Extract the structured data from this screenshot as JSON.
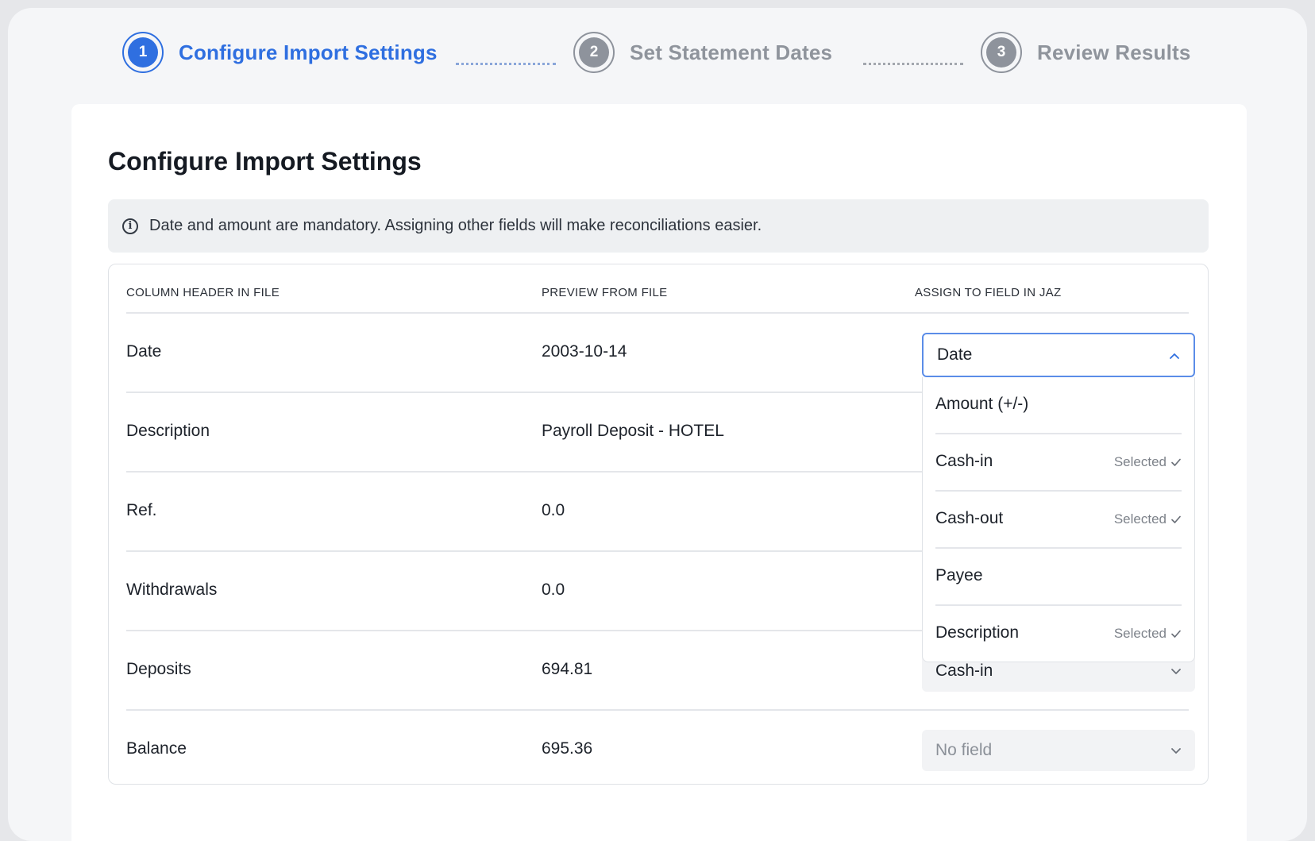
{
  "stepper": {
    "steps": [
      {
        "number": "1",
        "label": "Configure Import Settings"
      },
      {
        "number": "2",
        "label": "Set Statement Dates"
      },
      {
        "number": "3",
        "label": "Review Results"
      }
    ]
  },
  "page": {
    "title": "Configure Import Settings",
    "info": "Date and amount are mandatory. Assigning other fields will make reconciliations easier."
  },
  "table": {
    "headers": [
      "COLUMN HEADER IN FILE",
      "PREVIEW FROM FILE",
      "ASSIGN TO FIELD IN JAZ"
    ],
    "rows": [
      {
        "column": "Date",
        "preview": "2003-10-14",
        "assigned": "Date"
      },
      {
        "column": "Description",
        "preview": "Payroll Deposit - HOTEL",
        "assigned": ""
      },
      {
        "column": "Ref.",
        "preview": "0.0",
        "assigned": ""
      },
      {
        "column": "Withdrawals",
        "preview": "0.0",
        "assigned": ""
      },
      {
        "column": "Deposits",
        "preview": "694.81",
        "assigned": "Cash-in"
      },
      {
        "column": "Balance",
        "preview": "695.36",
        "assigned": "No field"
      }
    ]
  },
  "dropdown": {
    "options": [
      {
        "label": "Amount (+/-)",
        "status": ""
      },
      {
        "label": "Cash-in",
        "status": "Selected"
      },
      {
        "label": "Cash-out",
        "status": "Selected"
      },
      {
        "label": "Payee",
        "status": ""
      },
      {
        "label": "Description",
        "status": "Selected"
      }
    ]
  },
  "colors": {
    "accent": "#2f6fe0",
    "inactive_step": "#8e939c",
    "focus_border": "#5b8de8"
  }
}
